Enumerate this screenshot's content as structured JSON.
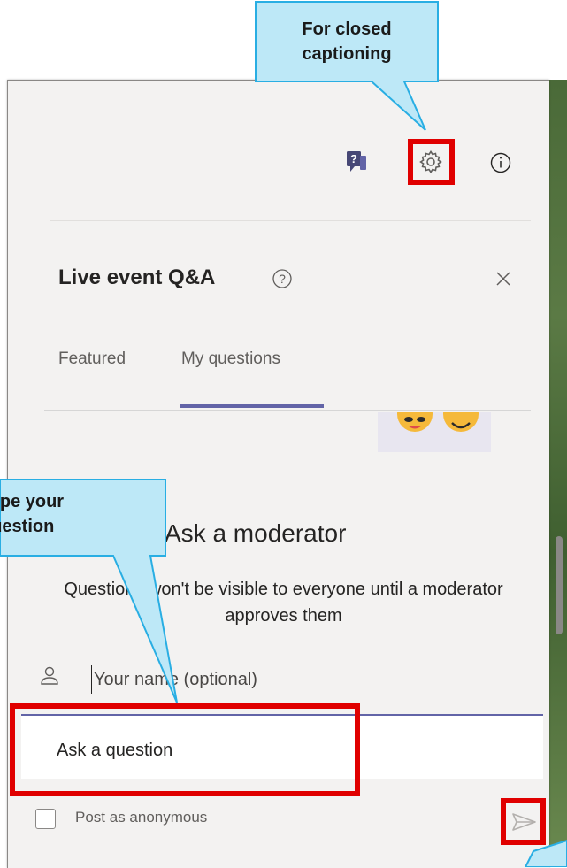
{
  "header": {
    "icons": [
      "qa-chat-icon",
      "gear-icon",
      "info-icon"
    ]
  },
  "qa": {
    "title": "Live event Q&A",
    "tabs": [
      {
        "label": "Featured",
        "active": false
      },
      {
        "label": "My questions",
        "active": true
      }
    ],
    "ask_heading": "Ask a moderator",
    "ask_description": "Questions won't be visible to everyone until a moderator approves them",
    "name_placeholder": "Your name (optional)",
    "question_placeholder": "Ask a question",
    "anonymous_label": "Post as anonymous",
    "anonymous_checked": false
  },
  "annotations": {
    "closed_caption_callout": "For closed captioning",
    "type_question_callout": "Type your question"
  },
  "colors": {
    "accent": "#6264a7",
    "highlight": "#e00000",
    "callout_fill": "#bde8f7",
    "callout_stroke": "#29aee3"
  }
}
